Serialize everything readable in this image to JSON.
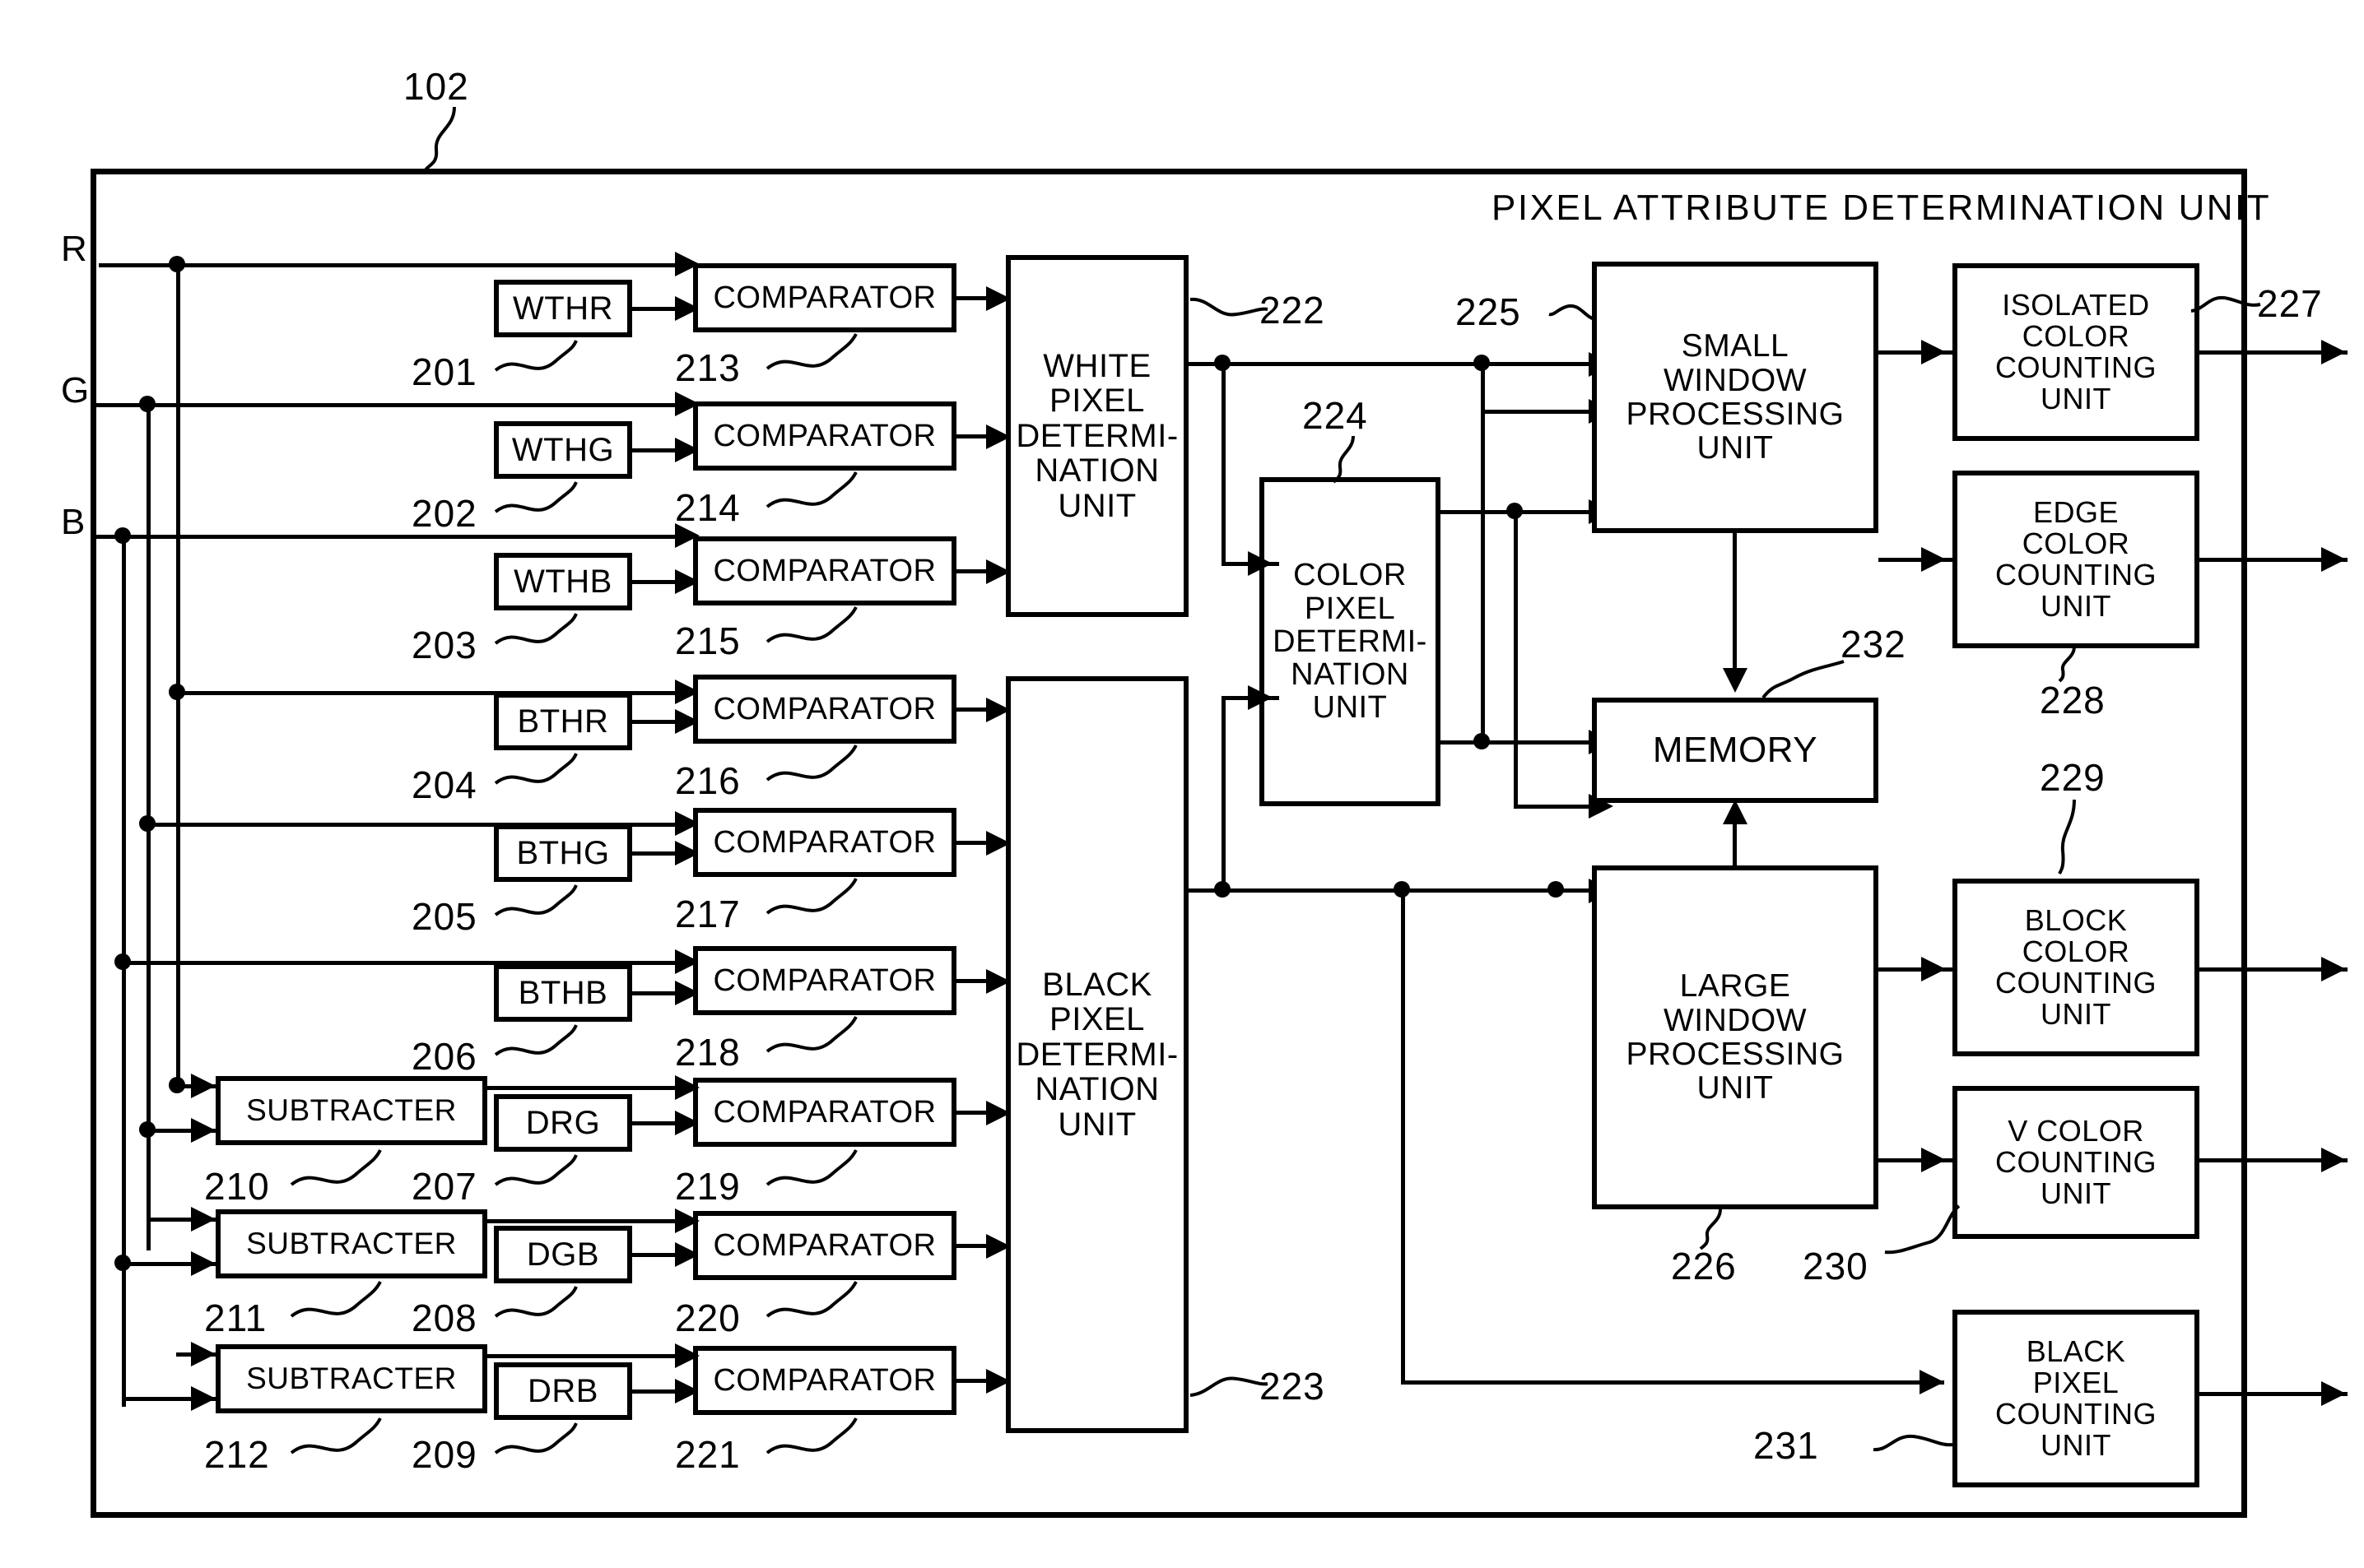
{
  "figure": {
    "top_ref": "102",
    "unit_title": "PIXEL ATTRIBUTE  DETERMINATION  UNIT",
    "input_ports": [
      "R",
      "G",
      "B"
    ]
  },
  "threshold_registers": [
    {
      "label": "WTHR",
      "ref": "201"
    },
    {
      "label": "WTHG",
      "ref": "202"
    },
    {
      "label": "WTHB",
      "ref": "203"
    },
    {
      "label": "BTHR",
      "ref": "204"
    },
    {
      "label": "BTHG",
      "ref": "205"
    },
    {
      "label": "BTHB",
      "ref": "206"
    },
    {
      "label": "DRG",
      "ref": "207"
    },
    {
      "label": "DGB",
      "ref": "208"
    },
    {
      "label": "DRB",
      "ref": "209"
    }
  ],
  "subtracters": [
    {
      "label": "SUBTRACTER",
      "ref": "210"
    },
    {
      "label": "SUBTRACTER",
      "ref": "211"
    },
    {
      "label": "SUBTRACTER",
      "ref": "212"
    }
  ],
  "comparators": [
    {
      "label": "COMPARATOR",
      "ref": "213"
    },
    {
      "label": "COMPARATOR",
      "ref": "214"
    },
    {
      "label": "COMPARATOR",
      "ref": "215"
    },
    {
      "label": "COMPARATOR",
      "ref": "216"
    },
    {
      "label": "COMPARATOR",
      "ref": "217"
    },
    {
      "label": "COMPARATOR",
      "ref": "218"
    },
    {
      "label": "COMPARATOR",
      "ref": "219"
    },
    {
      "label": "COMPARATOR",
      "ref": "220"
    },
    {
      "label": "COMPARATOR",
      "ref": "221"
    }
  ],
  "determination_units": {
    "white": {
      "label": "WHITE\nPIXEL\nDETERMI-\nNATION\nUNIT",
      "out_ref": "222"
    },
    "black": {
      "label": "BLACK\nPIXEL\nDETERMI-\nNATION\nUNIT",
      "out_ref": "223"
    },
    "color": {
      "label": "COLOR\nPIXEL\nDETERMI-\nNATION\nUNIT",
      "ref": "224"
    }
  },
  "processing_units": {
    "small_window": {
      "label": "SMALL\nWINDOW\nPROCESSING\nUNIT",
      "ref": "225"
    },
    "large_window": {
      "label": "LARGE\nWINDOW\nPROCESSING\nUNIT",
      "ref": "226"
    },
    "memory": {
      "label": "MEMORY",
      "ref": "232"
    }
  },
  "counting_units": [
    {
      "label": "ISOLATED\nCOLOR\nCOUNTING\nUNIT",
      "ref": "227"
    },
    {
      "label": "EDGE\nCOLOR\nCOUNTING\nUNIT",
      "ref": "228"
    },
    {
      "label": "BLOCK\nCOLOR\nCOUNTING\nUNIT",
      "ref": "229"
    },
    {
      "label": "V  COLOR\nCOUNTING\nUNIT",
      "ref": "230"
    },
    {
      "label": "BLACK\nPIXEL\nCOUNTING\nUNIT",
      "ref": "231"
    }
  ],
  "colors": {
    "ink": "#000000",
    "paper": "#ffffff"
  }
}
